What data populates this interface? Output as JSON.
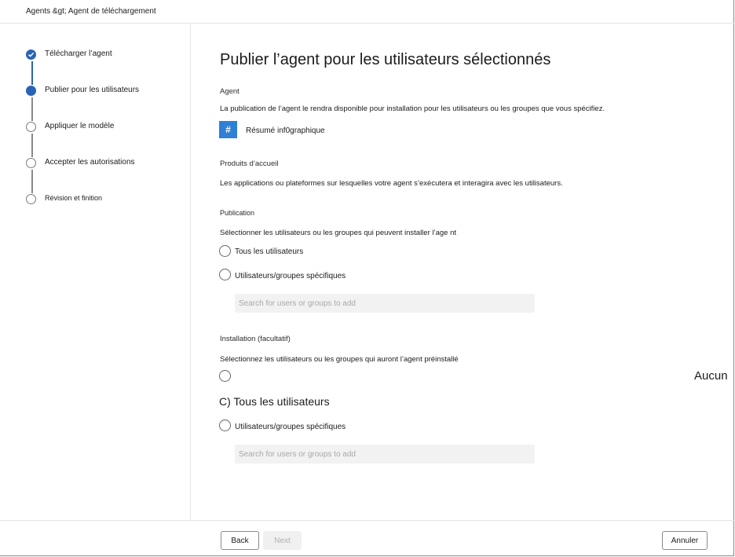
{
  "breadcrumb": "Agents &gt; Agent de téléchargement",
  "steps": [
    {
      "label": "Télécharger l’agent",
      "state": "done"
    },
    {
      "label": "Publier pour les utilisateurs",
      "state": "current"
    },
    {
      "label": "Appliquer le modèle",
      "state": "todo"
    },
    {
      "label": "Accepter les autorisations",
      "state": "todo"
    },
    {
      "label": "Révision et finition",
      "state": "todo"
    }
  ],
  "main": {
    "title": "Publier l’agent pour les utilisateurs sélectionnés",
    "agent": {
      "heading": "Agent",
      "description": "La publication de l’agent le rendra disponible pour installation pour les utilisateurs ou les groupes que vous spécifiez.",
      "icon_glyph": "#",
      "icon_color": "#2f7fd6",
      "name": "Résumé inf0graphique"
    },
    "products": {
      "heading": "Produits d’accueil",
      "description": "Les applications ou plateformes sur lesquelles votre agent s’exécutera et interagira avec les utilisateurs."
    },
    "publication": {
      "heading": "Publication",
      "description": "Sélectionner les utilisateurs ou les groupes qui peuvent installer l’age nt",
      "option_all": "Tous les utilisateurs",
      "option_specific": "Utilisateurs/groupes spécifiques",
      "search_placeholder": "Search for users or groups to add"
    },
    "installation": {
      "heading": "Installation (facultatif)",
      "description": "Sélectionnez les utilisateurs ou les groupes qui auront l’agent préinstallé",
      "option_none_label": "Aucun",
      "option_all_label": "C) Tous les utilisateurs",
      "option_specific": "Utilisateurs/groupes spécifiques",
      "search_placeholder": "Search for users or groups to add"
    }
  },
  "footer": {
    "back_label": "Back",
    "next_label": "Next",
    "cancel_label": "Annuler"
  },
  "colors": {
    "accent": "#2b63b5",
    "disabled": "#f0f0f0"
  }
}
